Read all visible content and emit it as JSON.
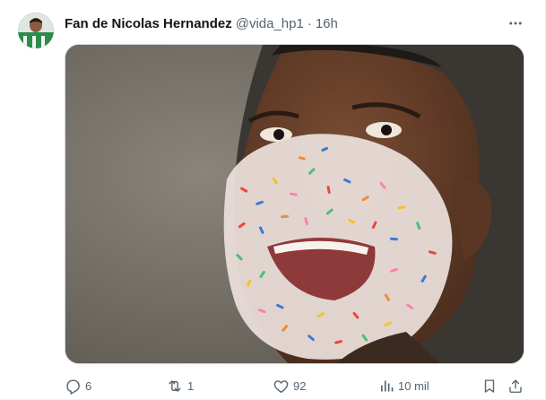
{
  "post": {
    "author_name": "Fan de Nicolas Hernandez",
    "handle": "@vida_hp1",
    "separator": "·",
    "time": "16h",
    "more_icon": "more-horizontal-icon",
    "media_description_hidden": true,
    "actions": {
      "reply": {
        "icon": "reply-icon",
        "count": "6"
      },
      "repost": {
        "icon": "repost-icon",
        "count": "1"
      },
      "like": {
        "icon": "heart-icon",
        "count": "92"
      },
      "views": {
        "icon": "analytics-icon",
        "count": "10 mil"
      },
      "bookmark": {
        "icon": "bookmark-icon"
      },
      "share": {
        "icon": "share-icon"
      }
    }
  },
  "colors": {
    "text_primary": "#0f1419",
    "text_secondary": "#536471",
    "border": "#cfd9de"
  }
}
